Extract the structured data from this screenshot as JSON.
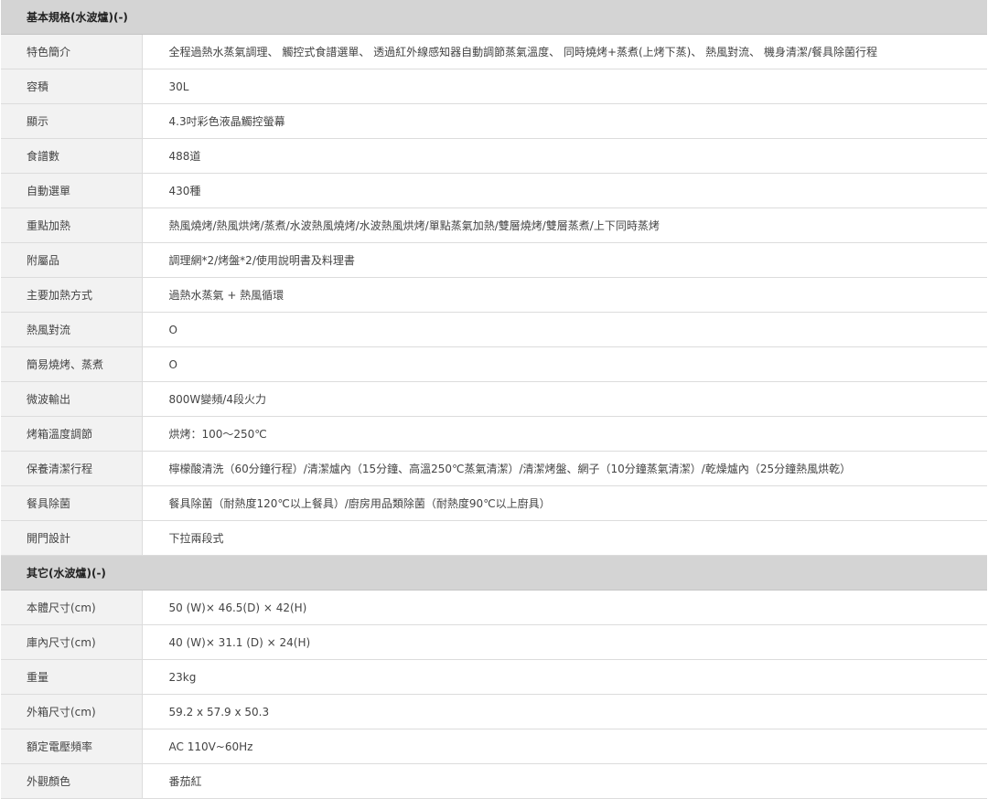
{
  "sections": [
    {
      "title": "基本規格(水波爐)(-)",
      "rows": [
        {
          "label": "特色簡介",
          "value": "全程過熱水蒸氣調理、 觸控式食譜選單、 透過紅外線感知器自動調節蒸氣溫度、 同時燒烤+蒸煮(上烤下蒸)、 熱風對流、 機身清潔/餐具除菌行程"
        },
        {
          "label": "容積",
          "value": "30L"
        },
        {
          "label": "顯示",
          "value": "4.3吋彩色液晶觸控螢幕"
        },
        {
          "label": "食譜數",
          "value": "488道"
        },
        {
          "label": "自動選單",
          "value": "430種"
        },
        {
          "label": "重點加熱",
          "value": "熱風燒烤/熱風烘烤/蒸煮/水波熱風燒烤/水波熱風烘烤/單點蒸氣加熱/雙層燒烤/雙層蒸煮/上下同時蒸烤"
        },
        {
          "label": "附屬品",
          "value": "調理網*2/烤盤*2/使用說明書及料理書"
        },
        {
          "label": "主要加熱方式",
          "value": "過熱水蒸氣 + 熱風循環"
        },
        {
          "label": "熱風對流",
          "value": "O"
        },
        {
          "label": "簡易燒烤、蒸煮",
          "value": "O"
        },
        {
          "label": "微波輸出",
          "value": "800W變頻/4段火力"
        },
        {
          "label": "烤箱溫度調節",
          "value": "烘烤：100～250℃"
        },
        {
          "label": "保養清潔行程",
          "value": "檸檬酸清洗（60分鐘行程）/清潔爐內（15分鐘、高溫250℃蒸氣清潔）/清潔烤盤、網子（10分鐘蒸氣清潔）/乾燥爐內（25分鐘熱風烘乾）"
        },
        {
          "label": "餐具除菌",
          "value": "餐具除菌（耐熱度120℃以上餐具）/廚房用品類除菌（耐熱度90℃以上廚具）"
        },
        {
          "label": "開門設計",
          "value": "下拉兩段式"
        }
      ]
    },
    {
      "title": "其它(水波爐)(-)",
      "rows": [
        {
          "label": "本體尺寸(cm)",
          "value": "50 (W)× 46.5(D) × 42(H)"
        },
        {
          "label": "庫內尺寸(cm)",
          "value": "40 (W)× 31.1 (D) × 24(H)"
        },
        {
          "label": "重量",
          "value": "23kg"
        },
        {
          "label": "外箱尺寸(cm)",
          "value": "59.2 x 57.9 x 50.3"
        },
        {
          "label": "額定電壓頻率",
          "value": "AC 110V~60Hz"
        },
        {
          "label": "外觀顏色",
          "value": "番茄紅"
        }
      ]
    }
  ]
}
